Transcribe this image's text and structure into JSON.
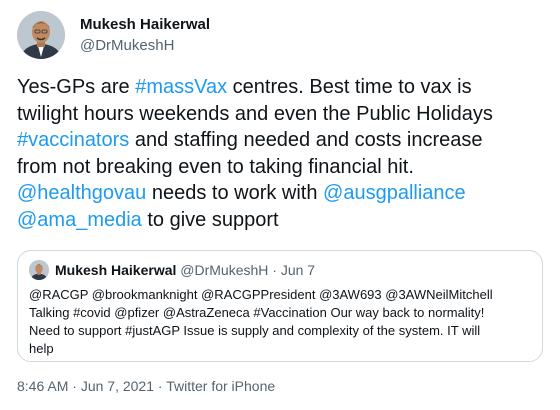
{
  "author": {
    "name": "Mukesh Haikerwal",
    "handle": "@DrMukeshH"
  },
  "tweet": {
    "line1_pre": "Yes-GPs are ",
    "line1_tag": "#massVax",
    "line1_post": " centres. Best time to vax is",
    "line2": "twilight hours weekends and even the Public Holidays",
    "line3_tag": "#vaccinators",
    "line3_post": " and staffing needed and costs increase",
    "line4": "from not breaking even to taking financial hit.",
    "line5_mention1": "@healthgovau",
    "line5_mid": " needs to work with ",
    "line5_mention2": "@ausgpalliance",
    "line6_mention": "@ama_media",
    "line6_post": " to give support"
  },
  "quoted_tweet": {
    "name": "Mukesh Haikerwal",
    "handle_date": "@DrMukeshH · Jun 7",
    "lines": [
      "@RACGP @brookmanknight @RACGPPresident @3AW693 @3AWNeilMitchell",
      "Talking #covid @pfizer @AstraZeneca #Vaccination Our way back to normality!",
      "Need to support #justAGP Issue is supply and complexity of the system. IT will",
      "help"
    ]
  },
  "footer": {
    "time": "8:46 AM",
    "separator": " · ",
    "date": "Jun 7, 2021",
    "source": "Twitter for iPhone"
  },
  "colors": {
    "link": "#1d9bf0",
    "text": "#0f1419",
    "muted": "#536471",
    "border": "#cfd9de"
  }
}
